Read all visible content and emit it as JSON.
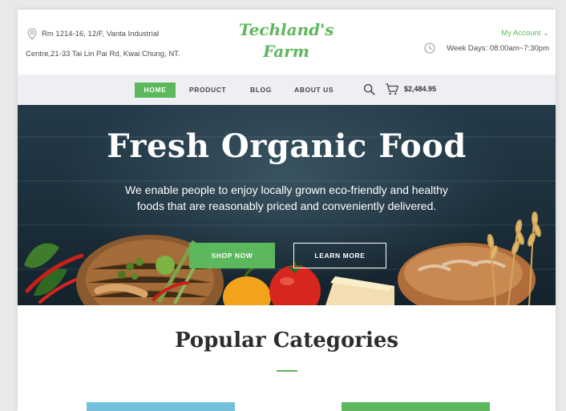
{
  "header": {
    "address_line1": "Rm 1214-16, 12/F, Vanta Industrial",
    "address_line2": "Centre,21-33 Tai Lin Pai Rd, Kwai Chung, NT.",
    "logo_line1": "Techland's",
    "logo_line2": "Farm",
    "account_label": "My Account ⌄",
    "hours": "Week Days: 08:00am~7:30pm"
  },
  "nav": {
    "items": [
      {
        "label": "HOME"
      },
      {
        "label": "PRODUCT"
      },
      {
        "label": "BLOG"
      },
      {
        "label": "ABOUT US"
      }
    ],
    "cart_total": "$2,484.95"
  },
  "hero": {
    "title": "Fresh Organic Food",
    "text": "We enable people to enjoy locally grown eco-friendly and healthy foods that are reasonably priced and conveniently delivered.",
    "shop_button": "SHOP NOW",
    "learn_button": "LEARN MORE"
  },
  "categories": {
    "title": "Popular Categories"
  },
  "colors": {
    "accent": "#5cb85c",
    "nav_bg": "#eeeff2",
    "hero_bg": "#1b2e3a",
    "card_blue": "#74c0dc"
  },
  "icons": {
    "address": "location-pin-icon",
    "hours": "clock-icon",
    "search": "search-icon",
    "cart": "cart-icon"
  }
}
